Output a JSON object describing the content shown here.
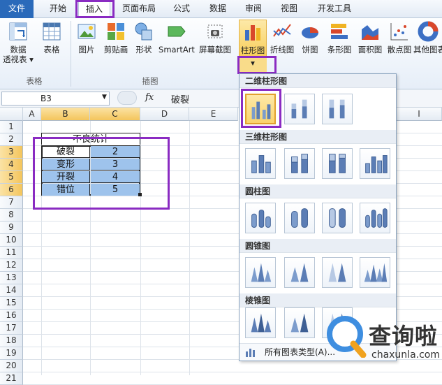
{
  "tabs": [
    "文件",
    "开始",
    "插入",
    "页面布局",
    "公式",
    "数据",
    "审阅",
    "视图",
    "开发工具"
  ],
  "ribbon": {
    "buttons": [
      {
        "label": "数据透视表",
        "line1": "数据",
        "line2": "透视表 ▾"
      },
      {
        "label": "表格"
      },
      {
        "label": "图片"
      },
      {
        "label": "剪贴画"
      },
      {
        "label": "形状"
      },
      {
        "label": "SmartArt"
      },
      {
        "label": "屏幕截图"
      },
      {
        "label": "柱形图"
      },
      {
        "label": "折线图"
      },
      {
        "label": "饼图"
      },
      {
        "label": "条形图"
      },
      {
        "label": "面积图"
      },
      {
        "label": "散点图"
      },
      {
        "label": "其他图表"
      }
    ],
    "groups": [
      "表格",
      "插图"
    ]
  },
  "formula": {
    "name_box": "B3",
    "fx": "fx",
    "value": "破裂"
  },
  "columns": [
    "A",
    "B",
    "C",
    "D",
    "E",
    "I"
  ],
  "rows": [
    "1",
    "2",
    "3",
    "4",
    "5",
    "6",
    "7",
    "8",
    "9",
    "10",
    "11",
    "12",
    "13",
    "14",
    "15",
    "16",
    "17",
    "18",
    "19",
    "20",
    "21"
  ],
  "table": {
    "title": "不良统计",
    "items": [
      {
        "name": "破裂",
        "value": "2"
      },
      {
        "name": "变形",
        "value": "3"
      },
      {
        "name": "开裂",
        "value": "4"
      },
      {
        "name": "错位",
        "value": "5"
      }
    ]
  },
  "gallery": {
    "sections": [
      "二维柱形图",
      "三维柱形图",
      "圆柱图",
      "圆锥图",
      "棱锥图"
    ],
    "all_types": "所有图表类型(A)..."
  },
  "watermark": {
    "brand": "查询啦",
    "url": "chaxunla.com"
  },
  "colors": {
    "accent": "#8a2bc2",
    "file_tab": "#2a6aba",
    "selection": "#9ec3ec"
  }
}
